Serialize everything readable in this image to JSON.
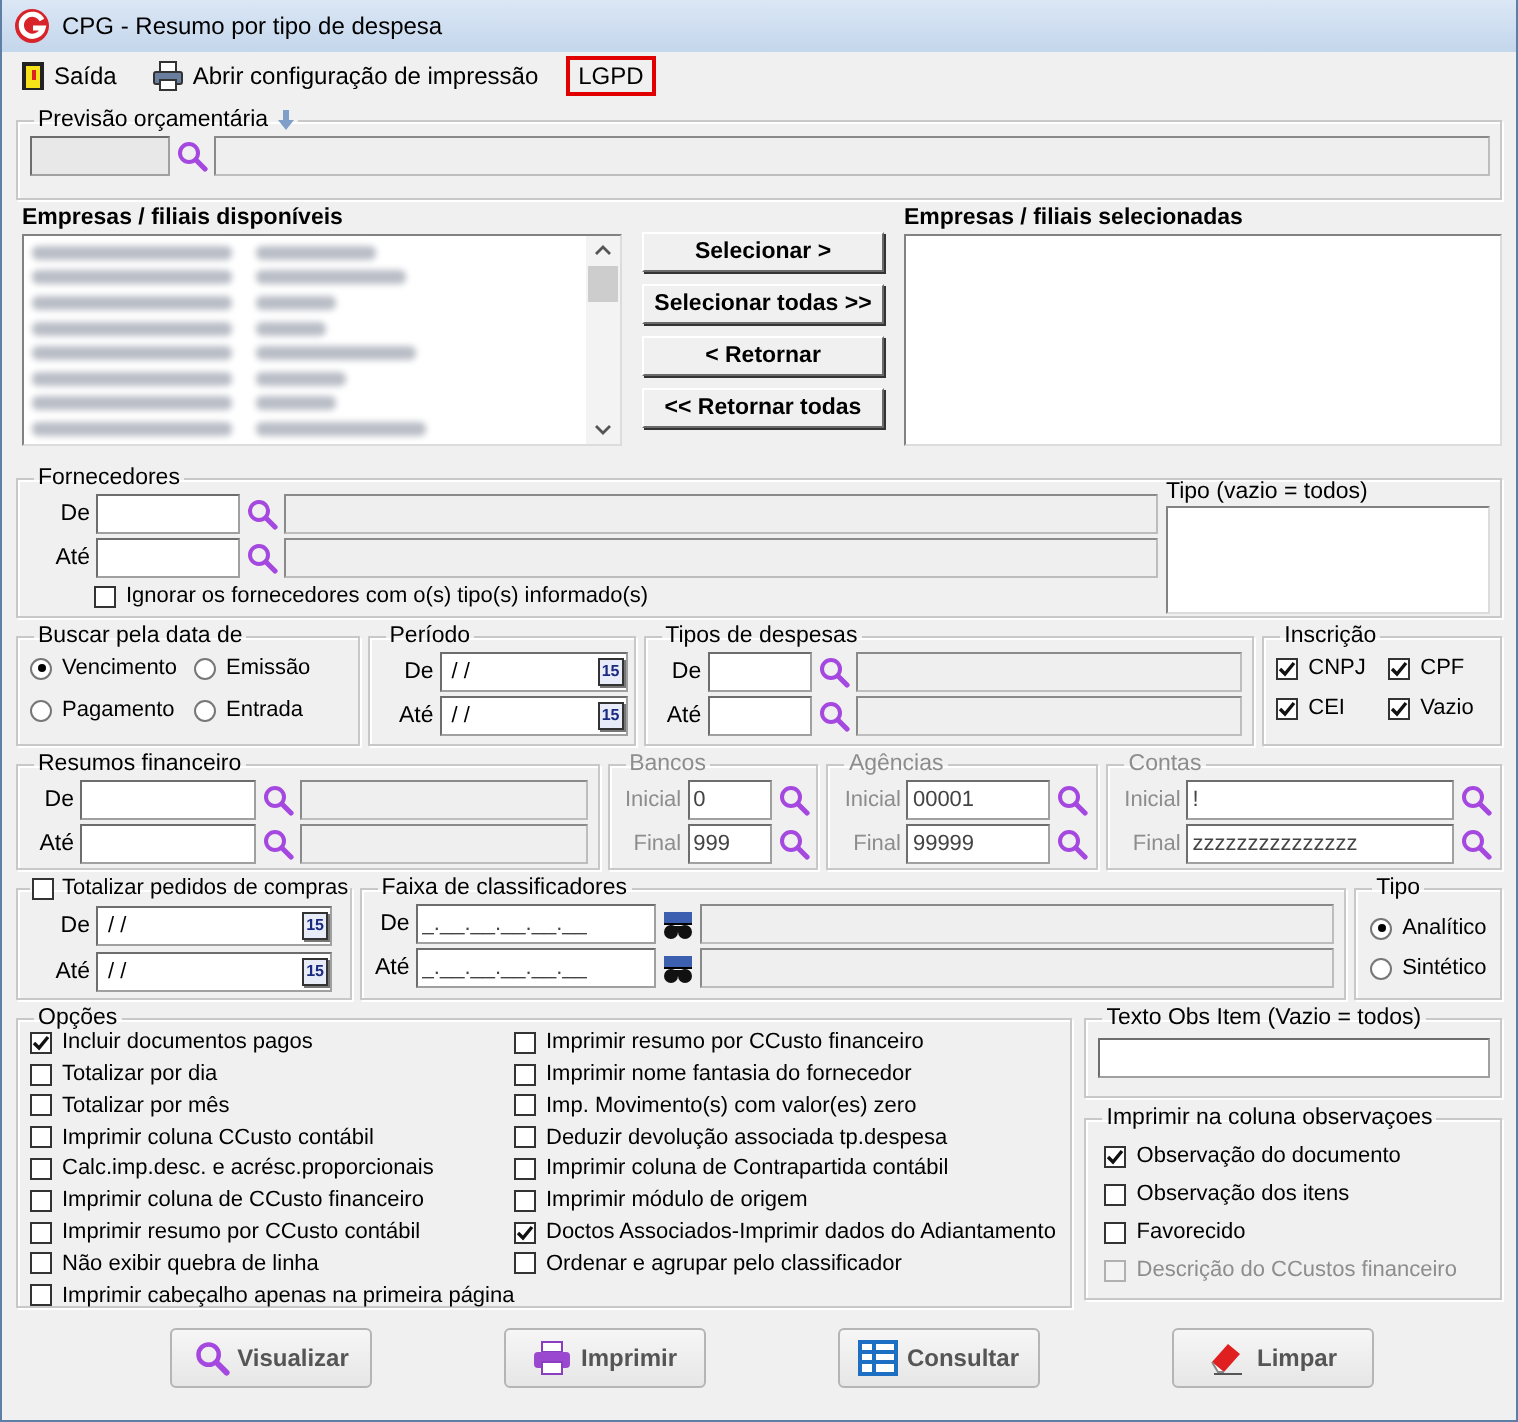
{
  "window": {
    "title": "CPG - Resumo por tipo de despesa"
  },
  "menu": [
    {
      "label": "Saída",
      "kind": "exit",
      "outlined": false
    },
    {
      "label": "Abrir configuração de impressão",
      "kind": "print",
      "outlined": false
    },
    {
      "label": "LGPD",
      "kind": "plain",
      "outlined": true
    }
  ],
  "previsao": {
    "label": "Previsão orçamentária",
    "code": {
      "disabled": true
    }
  },
  "empresas": {
    "available": {
      "label": "Empresas / filiais disponíveis",
      "items": [
        {
          "kind": "redacted"
        },
        {
          "kind": "redacted"
        },
        {
          "kind": "redacted"
        },
        {
          "kind": "redacted"
        },
        {
          "kind": "redacted"
        },
        {
          "kind": "redacted"
        },
        {
          "kind": "redacted"
        },
        {
          "kind": "redacted"
        }
      ]
    },
    "buttons": [
      {
        "label": "Selecionar >"
      },
      {
        "label": "Selecionar todas >>"
      },
      {
        "label": "< Retornar"
      },
      {
        "label": "<< Retornar todas"
      }
    ],
    "selected": {
      "label": "Empresas / filiais selecionadas"
    }
  },
  "fornecedores": {
    "label": "Fornecedores",
    "rows": [
      {
        "label": "De"
      },
      {
        "label": "Até"
      }
    ],
    "ignore": {
      "label": "Ignorar os fornecedores com o(s) tipo(s) informado(s)",
      "checked": false
    },
    "tipo": {
      "label": "Tipo (vazio = todos)"
    }
  },
  "buscar": {
    "label": "Buscar pela data de",
    "options": [
      {
        "label": "Vencimento",
        "selected": true
      },
      {
        "label": "Emissão",
        "selected": false
      },
      {
        "label": "Pagamento",
        "selected": false
      },
      {
        "label": "Entrada",
        "selected": false
      }
    ]
  },
  "periodo": {
    "label": "Período",
    "rows": [
      {
        "label": "De",
        "value": "/ /",
        "calendar": "15"
      },
      {
        "label": "Até",
        "value": "/ /",
        "calendar": "15"
      }
    ]
  },
  "tipos_despesas": {
    "label": "Tipos de despesas",
    "rows": [
      {
        "label": "De"
      },
      {
        "label": "Até"
      }
    ]
  },
  "inscricao": {
    "label": "Inscrição",
    "options": [
      {
        "label": "CNPJ",
        "checked": true
      },
      {
        "label": "CPF",
        "checked": true
      },
      {
        "label": "CEI",
        "checked": true
      },
      {
        "label": "Vazio",
        "checked": true
      }
    ]
  },
  "resumos": {
    "label": "Resumos financeiro",
    "rows": [
      {
        "label": "De"
      },
      {
        "label": "Até"
      }
    ]
  },
  "bancos": {
    "label": "Bancos",
    "disabled": true,
    "rows": [
      {
        "label": "Inicial",
        "value": "0"
      },
      {
        "label": "Final",
        "value": "999"
      }
    ]
  },
  "agencias": {
    "label": "Agências",
    "disabled": true,
    "rows": [
      {
        "label": "Inicial",
        "value": "00001"
      },
      {
        "label": "Final",
        "value": "99999"
      }
    ]
  },
  "contas": {
    "label": "Contas",
    "disabled": true,
    "rows": [
      {
        "label": "Inicial",
        "value": "!"
      },
      {
        "label": "Final",
        "value": "zzzzzzzzzzzzzzz"
      }
    ]
  },
  "totalizar": {
    "label": "Totalizar pedidos de compras",
    "checked": false,
    "rows": [
      {
        "label": "De",
        "value": "/ /",
        "calendar": "15"
      },
      {
        "label": "Até",
        "value": "/ /",
        "calendar": "15"
      }
    ]
  },
  "faixa": {
    "label": "Faixa de classificadores",
    "rows": [
      {
        "label": "De",
        "value": "_.__.__.__.__.__"
      },
      {
        "label": "Até",
        "value": "_.__.__.__.__.__"
      }
    ]
  },
  "tipo": {
    "label": "Tipo",
    "options": [
      {
        "label": "Analítico",
        "selected": true
      },
      {
        "label": "Sintético",
        "selected": false
      }
    ]
  },
  "opcoes": {
    "label": "Opções",
    "columns": [
      [
        {
          "label": "Incluir documentos pagos",
          "checked": true
        },
        {
          "label": "Totalizar por dia",
          "checked": false
        },
        {
          "label": "Totalizar por mês",
          "checked": false
        },
        {
          "label": "Imprimir coluna CCusto contábil",
          "checked": false
        },
        {
          "label": "Calc.imp.desc. e acrésc.proporcionais",
          "checked": false
        },
        {
          "label": "Imprimir coluna de CCusto financeiro",
          "checked": false
        },
        {
          "label": "Imprimir resumo por CCusto contábil",
          "checked": false
        },
        {
          "label": "Não exibir quebra de linha",
          "checked": false
        },
        {
          "label": "Imprimir cabeçalho apenas na primeira página",
          "checked": false
        }
      ],
      [
        {
          "label": "Imprimir resumo por CCusto financeiro",
          "checked": false
        },
        {
          "label": "Imprimir nome fantasia do fornecedor",
          "checked": false
        },
        {
          "label": "Imp. Movimento(s) com valor(es) zero",
          "checked": false
        },
        {
          "label": "Deduzir devolução associada tp.despesa",
          "checked": false
        },
        {
          "label": "Imprimir coluna de Contrapartida contábil",
          "checked": false
        },
        {
          "label": "Imprimir módulo de origem",
          "checked": false
        },
        {
          "label": "Doctos Associados-Imprimir dados do Adiantamento",
          "checked": true
        },
        {
          "label": "Ordenar e agrupar pelo classificador",
          "checked": false
        }
      ]
    ]
  },
  "texto_obs": {
    "label": "Texto Obs Item (Vazio = todos)"
  },
  "imprimir_obs": {
    "label": "Imprimir na coluna observaçoes",
    "options": [
      {
        "label": "Observação do documento",
        "checked": true,
        "disabled": false
      },
      {
        "label": "Observação dos itens",
        "checked": false,
        "disabled": false
      },
      {
        "label": "Favorecido",
        "checked": false,
        "disabled": false
      },
      {
        "label": "Descrição do CCustos financeiro",
        "checked": false,
        "disabled": true
      }
    ]
  },
  "actions": [
    {
      "label": "Visualizar",
      "kind": "search"
    },
    {
      "label": "Imprimir",
      "kind": "print"
    },
    {
      "label": "Consultar",
      "kind": "grid"
    },
    {
      "label": "Limpar",
      "kind": "erase"
    }
  ]
}
